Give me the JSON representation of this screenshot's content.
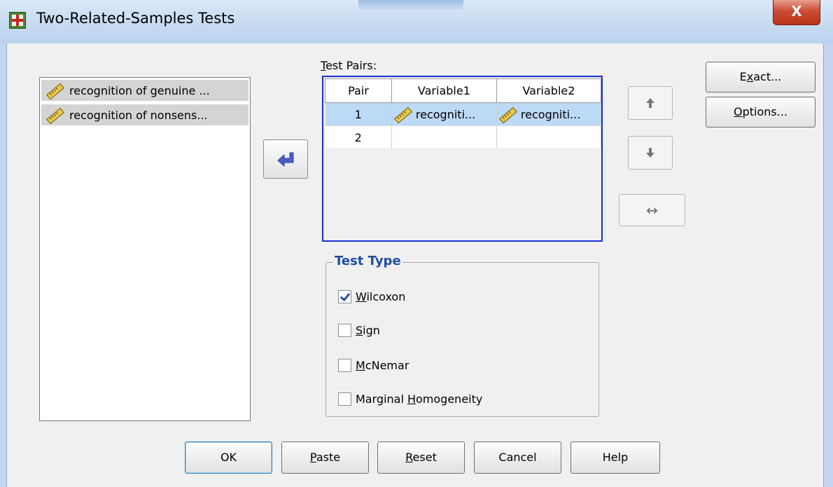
{
  "window": {
    "title": "Two-Related-Samples Tests",
    "close_label": "X"
  },
  "source_list": {
    "items": [
      {
        "label": "recognition of genuine ...",
        "icon": "scale-ruler-icon"
      },
      {
        "label": "recognition of nonsens...",
        "icon": "scale-ruler-icon"
      }
    ]
  },
  "test_pairs": {
    "label_prefix": "T",
    "label_rest": "est Pairs:",
    "columns": [
      "Pair",
      "Variable1",
      "Variable2"
    ],
    "rows": [
      {
        "pair": "1",
        "var1": "recogniti...",
        "var2": "recogniti...",
        "selected": true
      },
      {
        "pair": "2",
        "var1": "",
        "var2": "",
        "selected": false
      }
    ]
  },
  "buttons": {
    "exact_pre": "E",
    "exact_key": "x",
    "exact_post": "act...",
    "options_key": "O",
    "options_post": "ptions...",
    "ok": "OK",
    "paste_key": "P",
    "paste_post": "aste",
    "reset_key": "R",
    "reset_post": "eset",
    "cancel": "Cancel",
    "help": "Help",
    "move_up_glyph": "🡅",
    "move_down_glyph": "🡇",
    "swap_glyph": "↔"
  },
  "test_type": {
    "title": "Test Type",
    "options": [
      {
        "key": "W",
        "rest": "ilcoxon",
        "pre": "",
        "checked": true
      },
      {
        "key": "S",
        "rest": "ign",
        "pre": "",
        "checked": false
      },
      {
        "key": "M",
        "rest": "cNemar",
        "pre": "",
        "checked": false
      },
      {
        "key": "H",
        "rest": "omogeneity",
        "pre": "Marginal ",
        "checked": false
      }
    ]
  },
  "colors": {
    "accent_blue": "#1a2fd6",
    "selection": "#bcd9f5",
    "group_title": "#1f4ea1",
    "move_arrow": "#4a5fc8"
  }
}
